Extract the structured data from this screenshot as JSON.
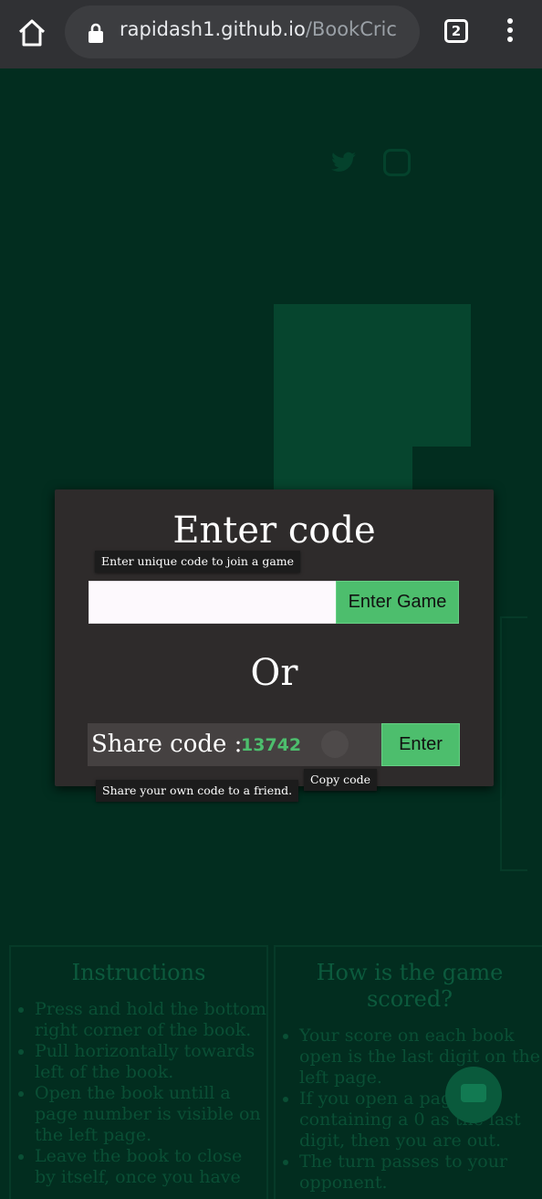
{
  "browser": {
    "url_host": "rapidash1.github.io",
    "url_path": "/BookCric",
    "tab_count": "2",
    "icons": [
      "home-icon",
      "lock-icon",
      "tab-switcher-icon",
      "more-vert-icon"
    ]
  },
  "background": {
    "instructions": {
      "heading": "Instructions",
      "items": [
        "Press and hold the bottom right corner of the book.",
        "Pull horizontally towards left of the book.",
        "Open the book untill a page number is visible on the left page.",
        "Leave the book to close by itself, once you have"
      ]
    },
    "scoring": {
      "heading": "How is the game scored?",
      "items": [
        "Your score on each book open is the last digit on the left page.",
        "If you open a page containing a 0 as the last digit, then you are out.",
        "The turn passes to your opponent."
      ]
    }
  },
  "modal": {
    "title": "Enter code",
    "join_tooltip": "Enter unique code to join a game",
    "code_input": {
      "value": "",
      "placeholder": ""
    },
    "enter_game_label": "Enter Game",
    "or_label": "Or",
    "share_label": "Share code :",
    "share_code": "13742",
    "enter_label": "Enter",
    "copy_tooltip": "Copy code",
    "share_tooltip": "Share your own code to a friend."
  },
  "colors": {
    "page_bg": "#022d1f",
    "modal_bg": "#2e2b2b",
    "accent_green": "#4dbe6d",
    "chrome_bg": "#303134"
  }
}
